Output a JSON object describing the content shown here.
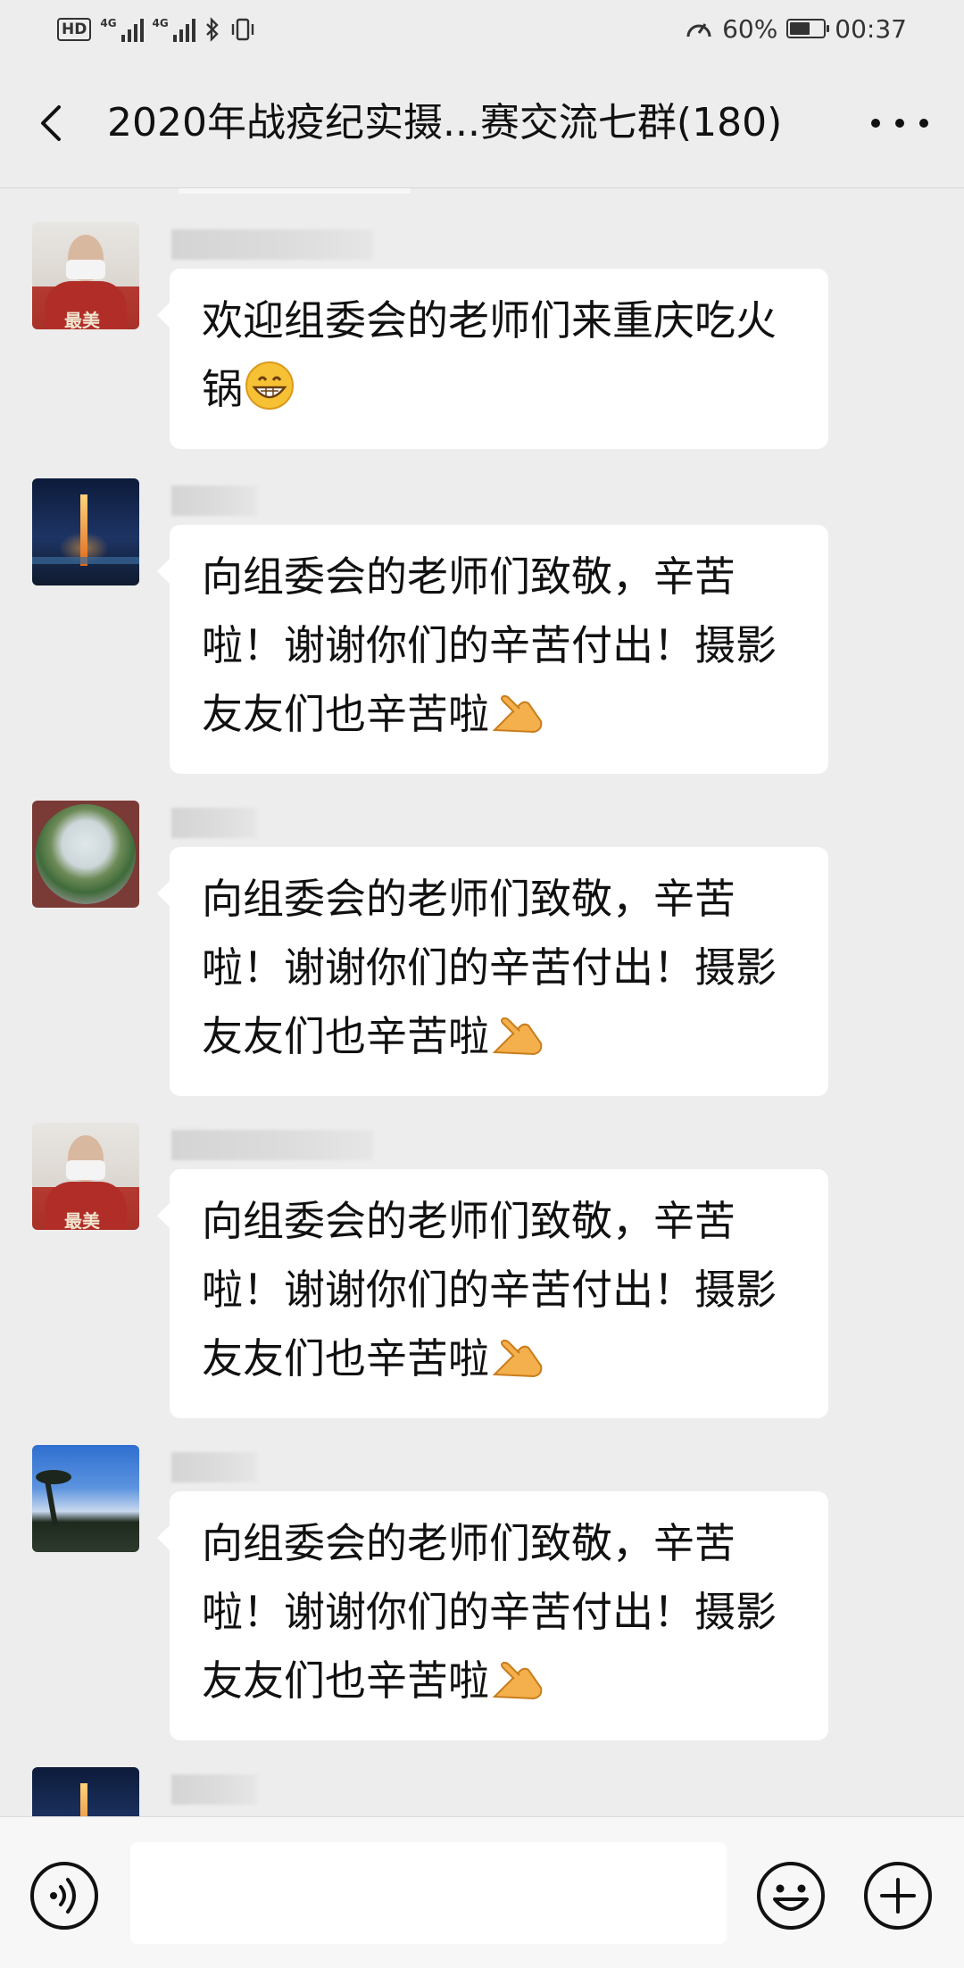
{
  "status_bar": {
    "hd": "HD",
    "network_1": "4G",
    "network_2": "4G",
    "battery_percent": "60%",
    "battery_level": 0.6,
    "time": "00:37"
  },
  "header": {
    "title": "2020年战疫纪实摄...赛交流七群(180)"
  },
  "messages": [
    {
      "text": "欢迎组委会的老师们来重庆吃火锅",
      "emoji": "grinning-face"
    },
    {
      "text": "向组委会的老师们致敬，辛苦啦！谢谢你们的辛苦付出！摄影友友们也辛苦啦",
      "emoji": "raised-hand"
    },
    {
      "text": "向组委会的老师们致敬，辛苦啦！谢谢你们的辛苦付出！摄影友友们也辛苦啦",
      "emoji": "raised-hand"
    },
    {
      "text": "向组委会的老师们致敬，辛苦啦！谢谢你们的辛苦付出！摄影友友们也辛苦啦",
      "emoji": "raised-hand"
    },
    {
      "text": "向组委会的老师们致敬，辛苦啦！谢谢你们的辛苦付出！摄影友友们也辛苦啦",
      "emoji": "raised-hand"
    }
  ],
  "avatars": {
    "person_caption": "最美"
  },
  "input_bar": {
    "placeholder": ""
  },
  "colors": {
    "background": "#ededed",
    "bubble": "#ffffff",
    "text": "#111111"
  }
}
